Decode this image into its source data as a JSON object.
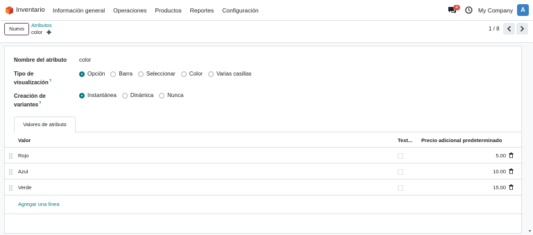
{
  "app": {
    "name": "Inventario",
    "menu": [
      "Información general",
      "Operaciones",
      "Productos",
      "Reportes",
      "Configuración"
    ],
    "notification_count": "4",
    "company": "My Company",
    "avatar_initial": "A"
  },
  "control": {
    "new_button": "Nuevo",
    "breadcrumb_parent": "Atributos",
    "breadcrumb_current": "color",
    "pager": "1 / 8"
  },
  "form": {
    "name_label": "Nombre del atributo",
    "name_value": "color",
    "display_type_label": "Tipo de visualización",
    "display_type_options": [
      {
        "label": "Opción",
        "checked": true
      },
      {
        "label": "Barra",
        "checked": false
      },
      {
        "label": "Seleccionar",
        "checked": false
      },
      {
        "label": "Color",
        "checked": false
      },
      {
        "label": "Varias casillas",
        "checked": false
      }
    ],
    "variant_creation_label": "Creación de variantes",
    "variant_creation_options": [
      {
        "label": "Instantánea",
        "checked": true
      },
      {
        "label": "Dinámica",
        "checked": false
      },
      {
        "label": "Nunca",
        "checked": false
      }
    ],
    "help_mark": "?"
  },
  "tab": {
    "label": "Valores de atributo"
  },
  "table": {
    "headers": {
      "value": "Valor",
      "text": "Text...",
      "price": "Precio adicional predeterminado"
    },
    "rows": [
      {
        "name": "Rojo",
        "price": "5.00"
      },
      {
        "name": "Azul",
        "price": "10.00"
      },
      {
        "name": "Verde",
        "price": "15.00"
      }
    ],
    "add_line": "Agregar una línea"
  },
  "colors": {
    "primary": "#714b67",
    "accent": "#017e84"
  },
  "icons": [
    "app-logo",
    "chat-icon",
    "clock-icon",
    "gear-icon",
    "chevron-left-icon",
    "chevron-right-icon",
    "drag-handle-icon",
    "trash-icon"
  ]
}
